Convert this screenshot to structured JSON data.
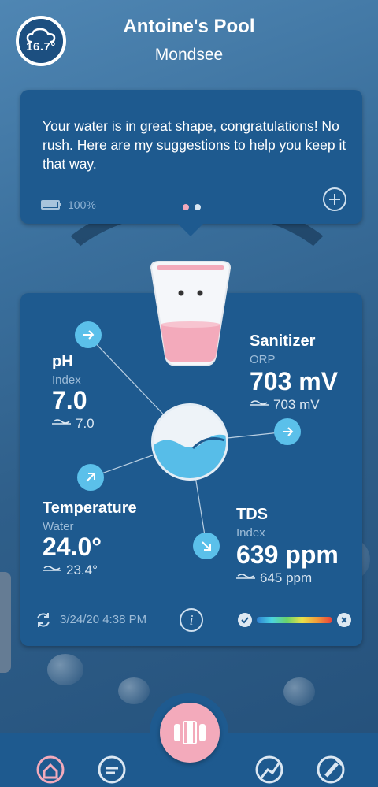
{
  "header": {
    "weather_temp": "16.7°",
    "pool_name": "Antoine's Pool",
    "location": "Mondsee"
  },
  "message_card": {
    "text": "Your water is in great shape, congratulations! No rush. Here are my suggestions to help you keep it that way.",
    "battery": "100%",
    "page_count": 2,
    "active_page": 0
  },
  "readings": {
    "ph": {
      "title": "pH",
      "subtitle": "Index",
      "value": "7.0",
      "average": "7.0"
    },
    "sanitizer": {
      "title": "Sanitizer",
      "subtitle": "ORP",
      "value": "703 mV",
      "average": "703 mV"
    },
    "temperature": {
      "title": "Temperature",
      "subtitle": "Water",
      "value": "24.0°",
      "average": "23.4°"
    },
    "tds": {
      "title": "TDS",
      "subtitle": "Index",
      "value": "639 ppm",
      "average": "645 ppm"
    },
    "timestamp": "3/24/20 4:38 PM"
  },
  "colors": {
    "card": "#1e5a8f",
    "accent_pink": "#f3aabb",
    "arrow_blue": "#5bc0ea"
  },
  "nav": {
    "items": [
      "home-icon",
      "chat-icon",
      "analytics-icon",
      "device-icon"
    ]
  }
}
